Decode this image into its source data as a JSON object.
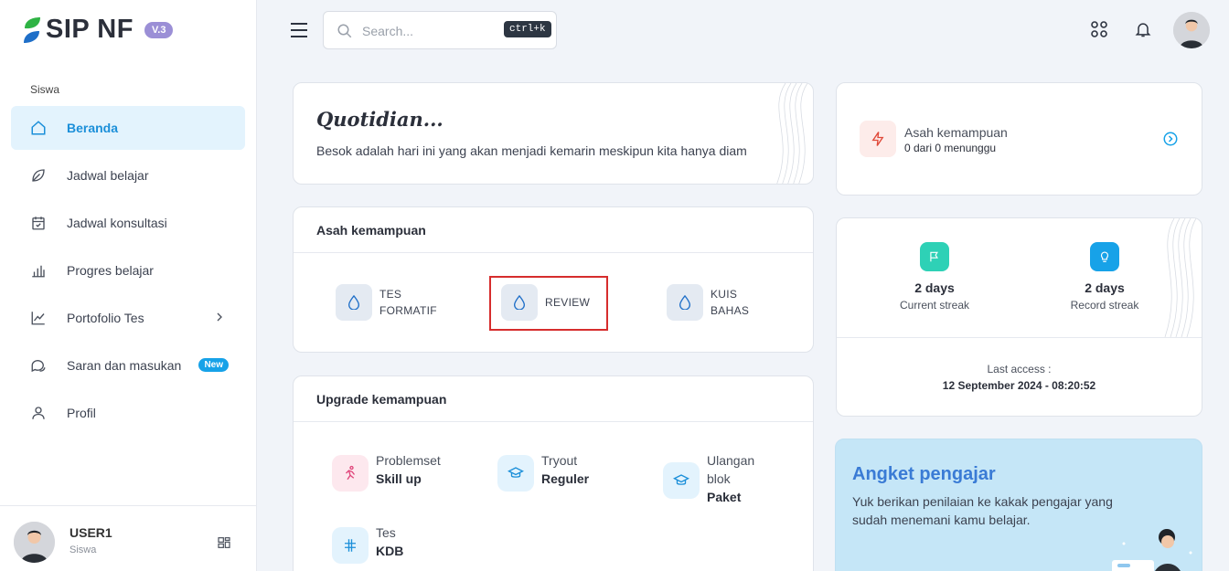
{
  "app": {
    "logo_text": "SIP NF",
    "version": "V.3",
    "brand_color": "#2fb344",
    "accent_color": "#1b8fd9"
  },
  "sidebar": {
    "section_label": "Siswa",
    "items": [
      {
        "label": "Beranda",
        "icon": "home-icon",
        "active": true
      },
      {
        "label": "Jadwal belajar",
        "icon": "leaf-icon"
      },
      {
        "label": "Jadwal konsultasi",
        "icon": "calendar-check-icon"
      },
      {
        "label": "Progres belajar",
        "icon": "bar-chart-icon"
      },
      {
        "label": "Portofolio Tes",
        "icon": "line-chart-icon",
        "has_submenu": true
      },
      {
        "label": "Saran dan masukan",
        "icon": "chat-icon",
        "badge": "New"
      },
      {
        "label": "Profil",
        "icon": "user-icon"
      }
    ],
    "user": {
      "name": "USER1",
      "role": "Siswa"
    }
  },
  "header": {
    "search_placeholder": "Search...",
    "shortcut": "ctrl+k"
  },
  "quote": {
    "title": "Quotidian...",
    "text": "Besok adalah hari ini yang akan menjadi kemarin meskipun kita hanya diam"
  },
  "asah": {
    "title": "Asah kemampuan",
    "items": [
      {
        "line1": "TES",
        "line2": "FORMATIF",
        "icon": "droplet-icon"
      },
      {
        "line1": "REVIEW",
        "icon": "droplet-icon",
        "highlighted": true
      },
      {
        "line1": "KUIS",
        "line2": "BAHAS",
        "icon": "droplet-icon"
      }
    ]
  },
  "upgrade": {
    "title": "Upgrade kemampuan",
    "items": [
      {
        "line1": "Problemset",
        "line2": "Skill up",
        "icon": "runner-icon"
      },
      {
        "line1": "Tryout",
        "line2": "Reguler",
        "icon": "graduation-cap-icon"
      },
      {
        "line1": "Ulangan",
        "line1b": "blok",
        "line2": "Paket",
        "icon": "graduation-cap-icon"
      },
      {
        "line1": "Tes",
        "line2": "KDB",
        "icon": "hash-icon"
      }
    ]
  },
  "pending": {
    "title": "Asah kemampuan",
    "subtitle": "0 dari 0 menunggu",
    "icon": "bolt-icon"
  },
  "streak": {
    "current": {
      "value": "2 days",
      "label": "Current streak",
      "icon": "flag-icon"
    },
    "record": {
      "value": "2 days",
      "label": "Record streak",
      "icon": "bulb-icon"
    },
    "last_access_label": "Last access :",
    "last_access_value": "12 September 2024 - 08:20:52"
  },
  "angket": {
    "title": "Angket pengajar",
    "text": "Yuk berikan penilaian ke kakak pengajar yang sudah menemani kamu belajar."
  }
}
